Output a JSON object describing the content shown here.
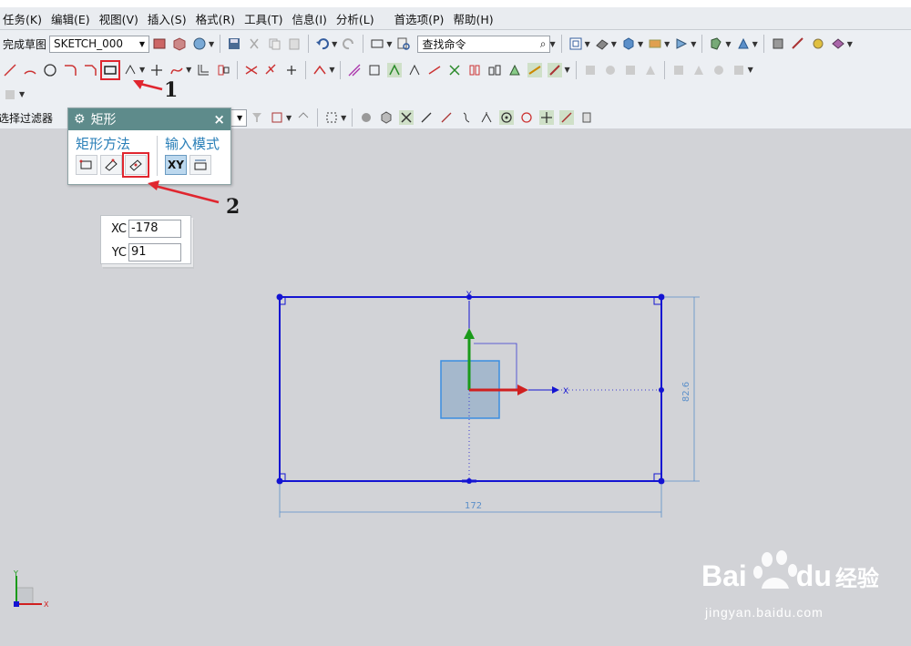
{
  "menu": [
    "任务(K)",
    "编辑(E)",
    "视图(V)",
    "插入(S)",
    "格式(R)",
    "工具(T)",
    "信息(I)",
    "分析(L)",
    "首选项(P)",
    "帮助(H)"
  ],
  "toolbar1": {
    "finish_sketch": "完成草图",
    "sketch_name": "SKETCH_000",
    "find_command": "查找命令"
  },
  "selection_bar": {
    "filter_label": "选择过滤器"
  },
  "rect_dialog": {
    "title": "矩形",
    "method_heading": "矩形方法",
    "input_heading": "输入模式",
    "xy_label": "XY",
    "selected_method": "从中心"
  },
  "coordinates": {
    "xc_label": "XC",
    "xc_value": "-178",
    "yc_label": "YC",
    "yc_value": "91"
  },
  "canvas": {
    "dim_width": "172",
    "dim_height": "82.6",
    "axis_x": "X",
    "axis_y": "Y"
  },
  "callouts": [
    "1",
    "2"
  ],
  "watermark": {
    "brand": "Bai",
    "brand2": "du",
    "cn": "经验",
    "url": "jingyan.baidu.com"
  },
  "colors": {
    "sketch_line": "#1414d2",
    "highlight": "#e0262f",
    "dialog_title_bg": "#5e8b8b",
    "dimension": "#5b8fc9"
  }
}
